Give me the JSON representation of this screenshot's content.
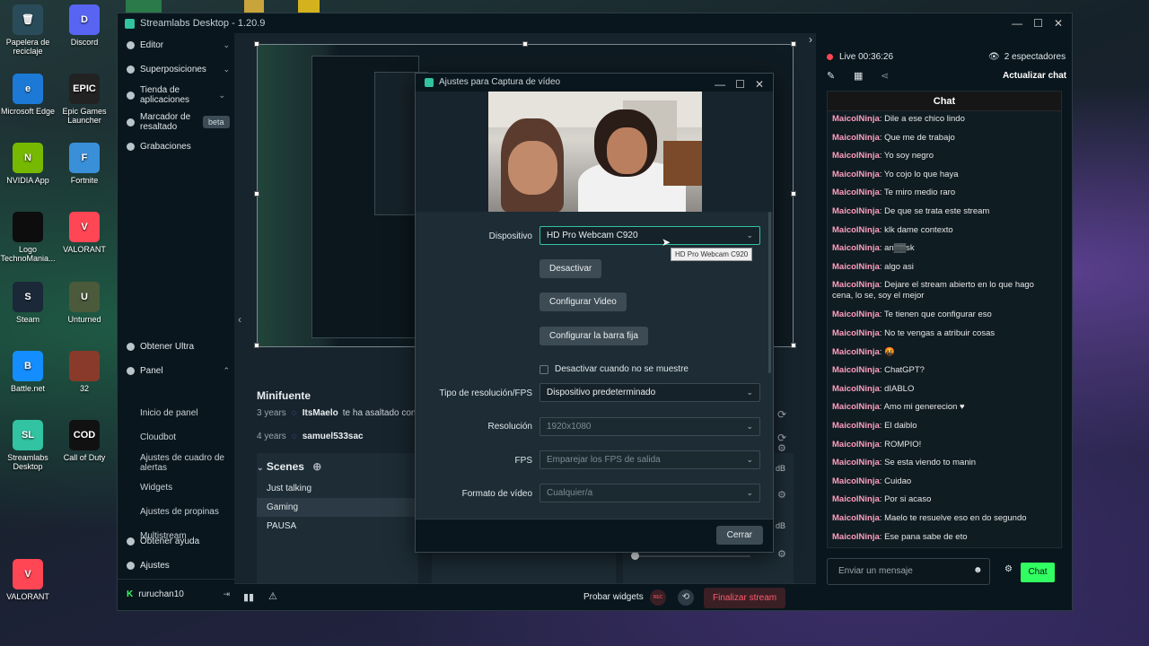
{
  "desktop": {
    "icons": [
      {
        "label": "Papelera de reciclaje",
        "glyph": "🗑",
        "color": "#2a4c5a"
      },
      {
        "label": "Discord",
        "glyph": "D",
        "color": "#5865f2"
      },
      {
        "label": "Microsoft Edge",
        "glyph": "e",
        "color": "#1c7ad6"
      },
      {
        "label": "Epic Games Launcher",
        "glyph": "EPIC",
        "color": "#222222"
      },
      {
        "label": "NVIDIA App",
        "glyph": "N",
        "color": "#76b900"
      },
      {
        "label": "Fortnite",
        "glyph": "F",
        "color": "#3a8fd9"
      },
      {
        "label": "Logo TechnoMania...",
        "glyph": "",
        "color": "#0d0d0d"
      },
      {
        "label": "VALORANT",
        "glyph": "V",
        "color": "#ff4655"
      },
      {
        "label": "Steam",
        "glyph": "S",
        "color": "#1b2838"
      },
      {
        "label": "Unturned",
        "glyph": "U",
        "color": "#4a5a3a"
      },
      {
        "label": "Battle.net",
        "glyph": "B",
        "color": "#148eff"
      },
      {
        "label": "32",
        "glyph": "",
        "color": "#8a3a2a"
      },
      {
        "label": "Streamlabs Desktop",
        "glyph": "SL",
        "color": "#31c3a2"
      },
      {
        "label": "Call of Duty",
        "glyph": "COD",
        "color": "#111111"
      },
      {
        "label": "VALORANT",
        "glyph": "V",
        "color": "#ff4655"
      }
    ]
  },
  "window": {
    "title": "Streamlabs Desktop - 1.20.9",
    "minimize": "—",
    "maximize": "☐",
    "close": "✕"
  },
  "sidebar": {
    "editor": "Editor",
    "overlays": "Superposiciones",
    "app_store": "Tienda de aplicaciones",
    "highlighter": "Marcador de resaltado",
    "beta": "beta",
    "recordings": "Grabaciones",
    "ultra": "Obtener Ultra",
    "panel": "Panel",
    "panel_items": [
      "Inicio de panel",
      "Cloudbot",
      "Ajustes de cuadro de alertas",
      "Widgets",
      "Ajustes de propinas",
      "Multistream"
    ],
    "help": "Obtener ayuda",
    "settings": "Ajustes",
    "username": "ruruchan10"
  },
  "main": {
    "minifeed_title": "Minifuente",
    "feed": [
      {
        "time": "3 years",
        "user": "ItsMaelo",
        "text": "te ha asaltado con"
      },
      {
        "time": "4 years",
        "user": "samuel533sac",
        "text": ""
      }
    ],
    "scenes_title": "Scenes",
    "scenes": [
      "Just talking",
      "Gaming",
      "PAUSA"
    ],
    "db1": "dB",
    "db2": "dB",
    "test_widgets": "Probar widgets",
    "rec": "REC",
    "end_stream": "Finalizar stream"
  },
  "chat": {
    "live": "Live 00:36:26",
    "viewers": "2 espectadores",
    "refresh": "Actualizar chat",
    "header": "Chat",
    "messages": [
      {
        "user": "MaicolNinja",
        "text": "Dile a ese chico lindo"
      },
      {
        "user": "MaicolNinja",
        "text": "Que me de trabajo"
      },
      {
        "user": "MaicolNinja",
        "text": "Yo soy negro"
      },
      {
        "user": "MaicolNinja",
        "text": "Yo cojo lo que haya"
      },
      {
        "user": "MaicolNinja",
        "text": "Te miro medio raro"
      },
      {
        "user": "MaicolNinja",
        "text": "De que se trata este stream"
      },
      {
        "user": "MaicolNinja",
        "text": "klk dame contexto"
      },
      {
        "user": "MaicolNinja",
        "text": "an▒▒sk"
      },
      {
        "user": "MaicolNinja",
        "text": "algo asi"
      },
      {
        "user": "MaicolNinja",
        "text": "Dejare el stream abierto en lo que hago cena, lo se, soy el mejor"
      },
      {
        "user": "MaicolNinja",
        "text": "Te tienen que configurar eso"
      },
      {
        "user": "MaicolNinja",
        "text": "No te vengas a atribuir cosas"
      },
      {
        "user": "MaicolNinja",
        "text": "🤬"
      },
      {
        "user": "MaicolNinja",
        "text": "ChatGPT?"
      },
      {
        "user": "MaicolNinja",
        "text": "dIABLO"
      },
      {
        "user": "MaicolNinja",
        "text": "Amo mi generecion ♥"
      },
      {
        "user": "MaicolNinja",
        "text": "El daiblo"
      },
      {
        "user": "MaicolNinja",
        "text": "ROMPIO!"
      },
      {
        "user": "MaicolNinja",
        "text": "Se esta viendo to manin"
      },
      {
        "user": "MaicolNinja",
        "text": "Cuidao"
      },
      {
        "user": "MaicolNinja",
        "text": "Por si acaso"
      },
      {
        "user": "MaicolNinja",
        "text": "Maelo te resuelve eso en do segundo"
      },
      {
        "user": "MaicolNinja",
        "text": "Ese pana sabe de eto"
      }
    ],
    "placeholder": "Enviar un mensaje",
    "send": "Chat"
  },
  "dialog": {
    "title": "Ajustes para Captura de vídeo",
    "device_label": "Dispositivo",
    "device_value": "HD Pro Webcam C920",
    "tooltip": "HD Pro Webcam C920",
    "deactivate": "Desactivar",
    "configure_video": "Configurar Video",
    "configure_crossbar": "Configurar la barra fija",
    "checkbox_label": "Desactivar cuando no se muestre",
    "res_type_label": "Tipo de resolución/FPS",
    "res_type_value": "Dispositivo predeterminado",
    "resolution_label": "Resolución",
    "resolution_value": "1920x1080",
    "fps_label": "FPS",
    "fps_value": "Emparejar los FPS de salida",
    "format_label": "Formato de vídeo",
    "format_value": "Cualquier/a",
    "close": "Cerrar"
  }
}
